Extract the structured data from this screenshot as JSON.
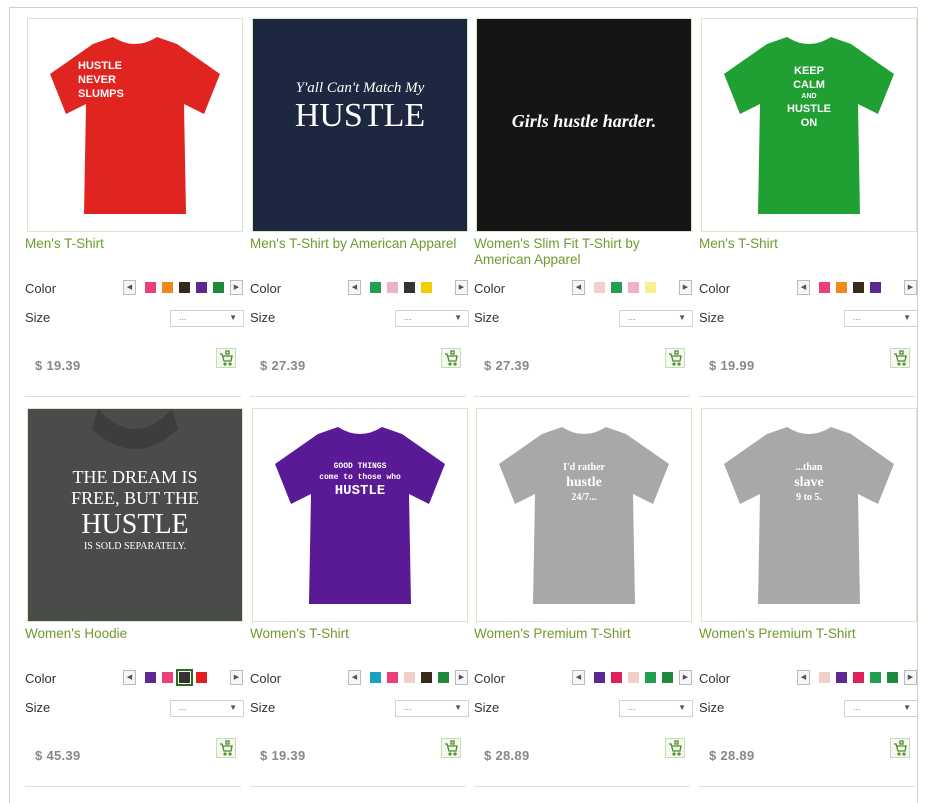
{
  "labels": {
    "color": "Color",
    "size": "Size",
    "size_placeholder": "...",
    "prev": "◀",
    "next": "▶"
  },
  "products": [
    {
      "title": "Men's T-Shirt",
      "price": "$ 19.39",
      "shirt_color": "#e0241f",
      "print": [
        "HUSTLE",
        "NEVER",
        "SLUMPS"
      ],
      "swatches": [
        "#e8407a",
        "#f08a1a",
        "#3a2a1a",
        "#5a2a90",
        "#208a3a"
      ]
    },
    {
      "title": "Men's T-Shirt by American Apparel",
      "price": "$ 27.39",
      "shirt_color": "#1e2740",
      "print": [
        "Y'all Can't Match My",
        "HUSTLE"
      ],
      "swatches": [
        "#20a050",
        "#f0b0c8",
        "#333333",
        "#f0d000"
      ]
    },
    {
      "title": "Women's Slim Fit T-Shirt by American Apparel",
      "price": "$ 27.39",
      "shirt_color": "#151515",
      "print": [
        "Girls hustle harder."
      ],
      "swatches": [
        "#f0d0c8",
        "#20a050",
        "#f0b0c8",
        "#f8f090"
      ]
    },
    {
      "title": "Men's T-Shirt",
      "price": "$ 19.99",
      "shirt_color": "#20a033",
      "print": [
        "KEEP",
        "CALM",
        "AND",
        "HUSTLE",
        "ON"
      ],
      "swatches": [
        "#e8407a",
        "#f08a1a",
        "#3a2a1a",
        "#5a2a90"
      ]
    },
    {
      "title": "Women's Hoodie",
      "price": "$ 45.39",
      "shirt_color": "#4a4c4a",
      "print": [
        "THE DREAM IS",
        "FREE, BUT THE",
        "HUSTLE",
        "IS SOLD SEPARATELY."
      ],
      "swatches": [
        "#5a2a90",
        "#e8407a",
        "#333333",
        "#e02020"
      ]
    },
    {
      "title": "Women's T-Shirt",
      "price": "$ 19.39",
      "shirt_color": "#5a1a96",
      "print": [
        "GOOD THINGS",
        "come to those who",
        "HUSTLE"
      ],
      "swatches": [
        "#1aa0c0",
        "#e8407a",
        "#f0d0c8",
        "#3a2a1a",
        "#208a3a"
      ]
    },
    {
      "title": "Women's Premium T-Shirt",
      "price": "$ 28.89",
      "shirt_color": "#a8a8a8",
      "print": [
        "I'd rather",
        "hustle",
        "24/7..."
      ],
      "swatches": [
        "#5a2a90",
        "#e0205a",
        "#f0d0c8",
        "#20a050",
        "#208a3a"
      ]
    },
    {
      "title": "Women's Premium T-Shirt",
      "price": "$ 28.89",
      "shirt_color": "#a8a8a8",
      "print": [
        "...than",
        "slave",
        "9 to 5."
      ],
      "swatches": [
        "#f0d0c8",
        "#5a2a90",
        "#e0205a",
        "#20a050",
        "#208a3a"
      ]
    }
  ]
}
